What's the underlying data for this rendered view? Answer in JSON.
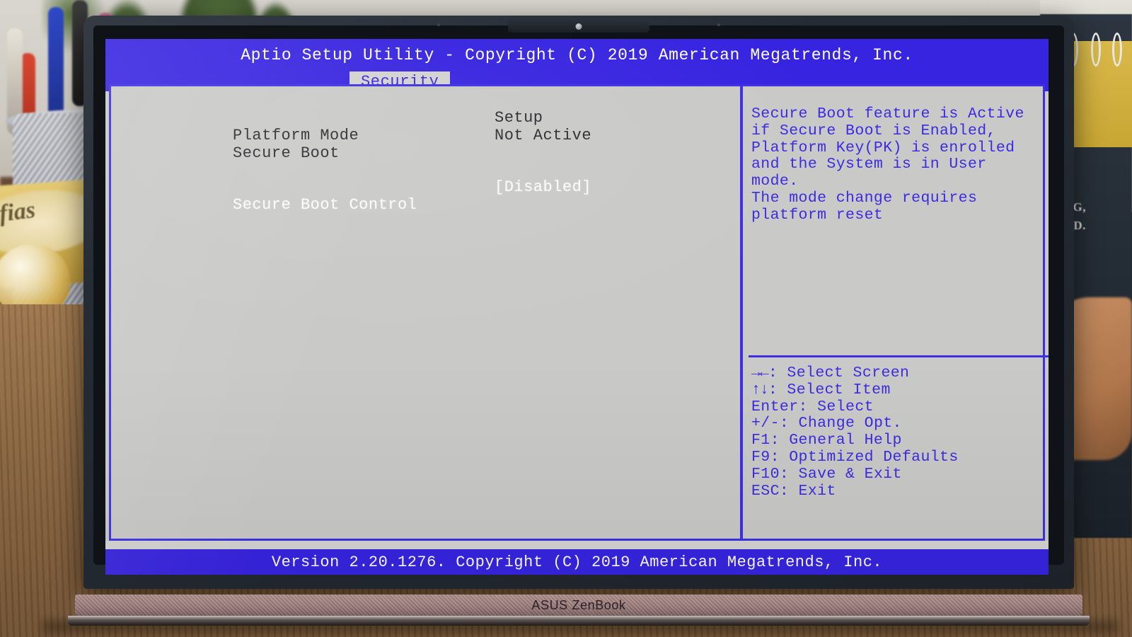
{
  "window": {
    "title": "Aptio Setup Utility - Copyright (C) 2019 American Megatrends, Inc.",
    "footer": "Version 2.20.1276. Copyright (C) 2019 American Megatrends, Inc.",
    "accent_blue": "#3724e0",
    "screen_bg": "#c9c9c7",
    "text_color": "#2b2b30",
    "highlight_color": "#fbfbfb"
  },
  "tabs": [
    {
      "label": "Security",
      "active": true
    }
  ],
  "settings": [
    {
      "label": "Platform Mode",
      "value": "Setup",
      "selected": false
    },
    {
      "label": "Secure Boot",
      "value": "Not Active",
      "selected": false
    },
    {
      "label": "Secure Boot Control",
      "value": "[Disabled]",
      "selected": true
    }
  ],
  "help": {
    "text": "Secure Boot feature is Active\nif Secure Boot is Enabled,\nPlatform Key(PK) is enrolled\nand the System is in User mode.\nThe mode change requires\nplatform reset"
  },
  "key_legend": [
    {
      "glyph": "→←",
      "keys": "",
      "action": ": Select Screen"
    },
    {
      "glyph": "↑↓",
      "keys": "",
      "action": ": Select Item"
    },
    {
      "glyph": "",
      "keys": "Enter",
      "action": ": Select"
    },
    {
      "glyph": "",
      "keys": "+/-",
      "action": ": Change Opt."
    },
    {
      "glyph": "",
      "keys": "F1",
      "action": ": General Help"
    },
    {
      "glyph": "",
      "keys": "F9",
      "action": ": Optimized Defaults"
    },
    {
      "glyph": "",
      "keys": "F10",
      "action": ": Save & Exit"
    },
    {
      "glyph": "",
      "keys": "ESC",
      "action": ": Exit"
    }
  ],
  "hardware": {
    "brand": "ASUS ZenBook"
  },
  "background": {
    "book_text": "ofias",
    "poster_line1": "N WEG,",
    "poster_line2": "N SIND."
  }
}
